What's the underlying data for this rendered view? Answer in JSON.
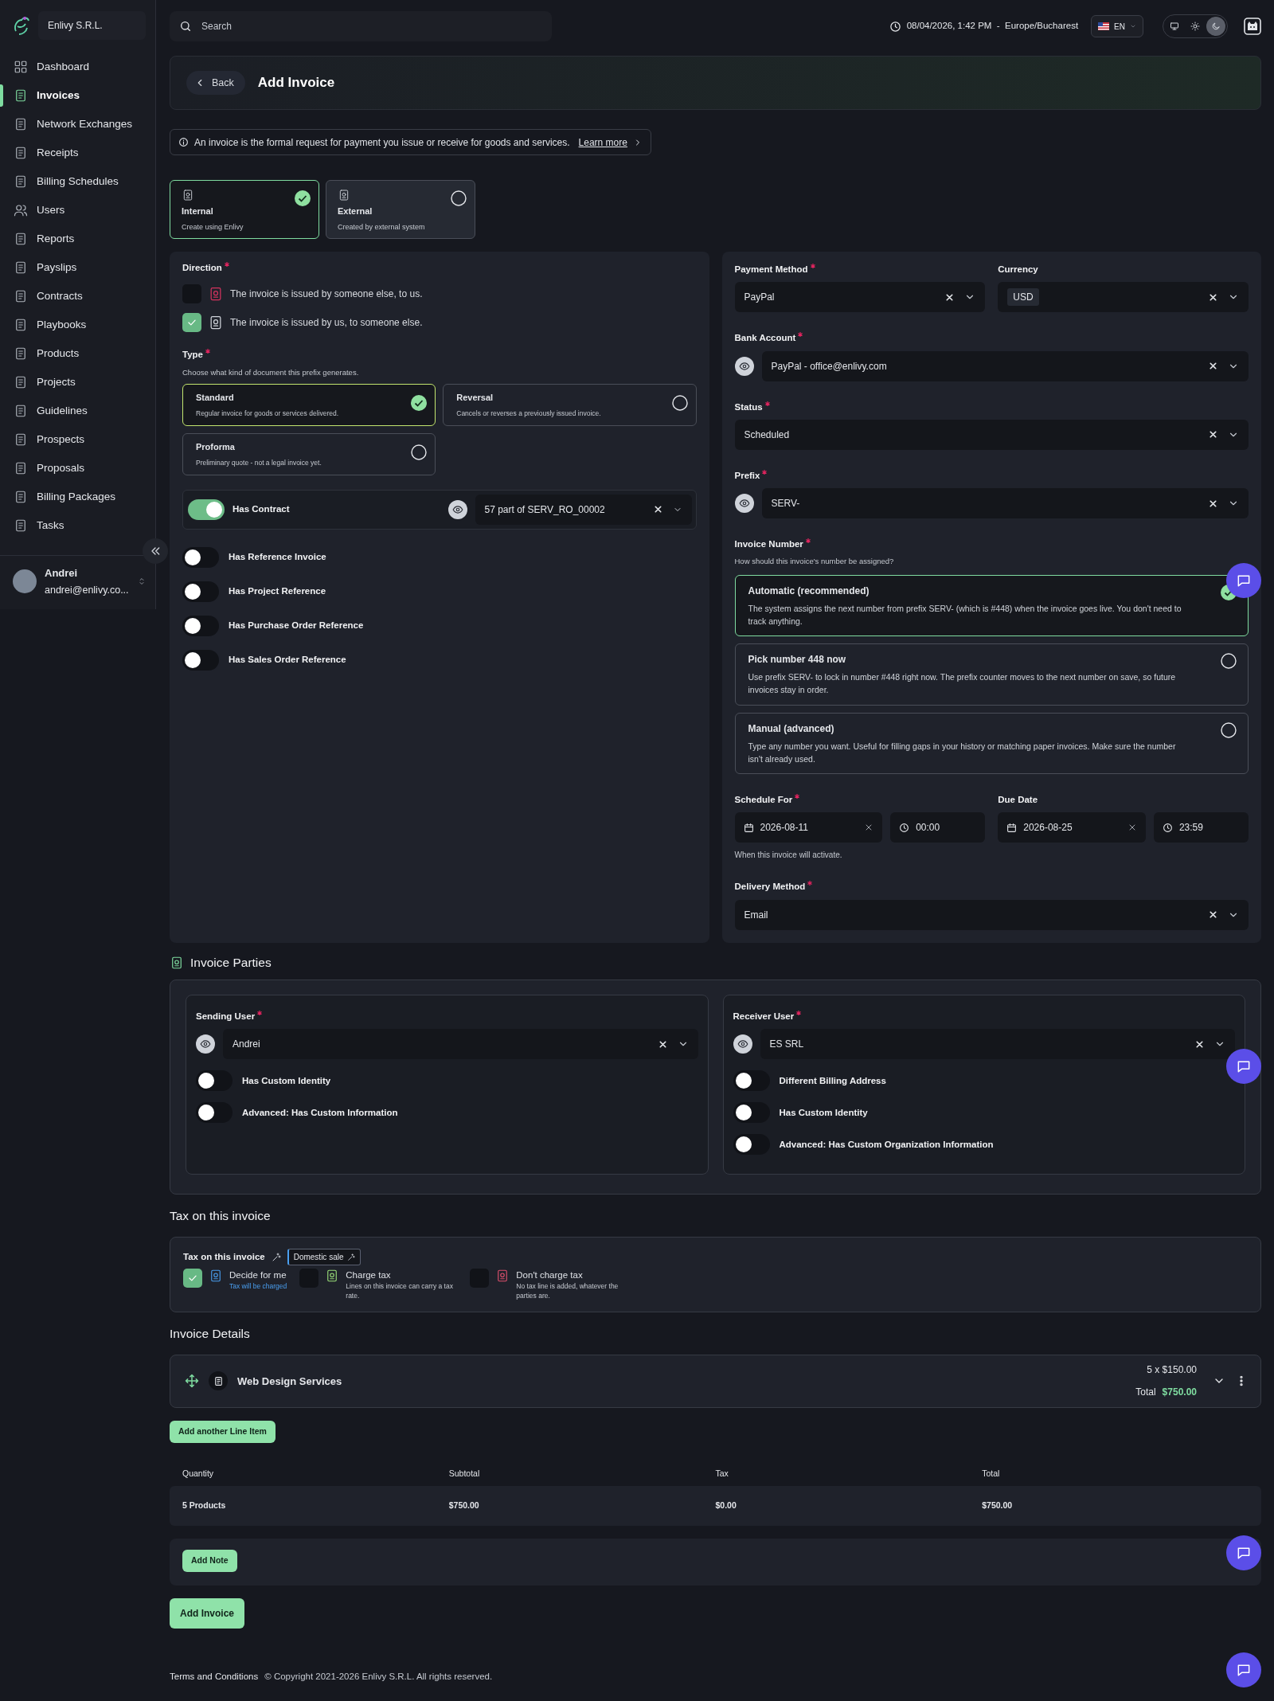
{
  "sidebar": {
    "company": "Enlivy S.R.L.",
    "items": [
      {
        "label": "Dashboard",
        "selected": false
      },
      {
        "label": "Invoices",
        "selected": true
      },
      {
        "label": "Network Exchanges",
        "selected": false
      },
      {
        "label": "Receipts",
        "selected": false
      },
      {
        "label": "Billing Schedules",
        "selected": false
      },
      {
        "label": "Users",
        "selected": false
      },
      {
        "label": "Reports",
        "selected": false
      },
      {
        "label": "Payslips",
        "selected": false
      },
      {
        "label": "Contracts",
        "selected": false
      },
      {
        "label": "Playbooks",
        "selected": false
      },
      {
        "label": "Products",
        "selected": false
      },
      {
        "label": "Projects",
        "selected": false
      },
      {
        "label": "Guidelines",
        "selected": false
      },
      {
        "label": "Prospects",
        "selected": false
      },
      {
        "label": "Proposals",
        "selected": false
      },
      {
        "label": "Billing Packages",
        "selected": false
      },
      {
        "label": "Tasks",
        "selected": false
      }
    ],
    "user": {
      "name": "Andrei",
      "email": "andrei@enlivy.co..."
    }
  },
  "topbar": {
    "search": {
      "placeholder": "Search"
    },
    "datetime": "08/04/2026, 1:42 PM  -  Europe/Bucharest",
    "language": "EN",
    "theme_modes": [
      {
        "kind": "system",
        "selected": false
      },
      {
        "kind": "light",
        "selected": false
      },
      {
        "kind": "dark",
        "selected": true
      }
    ]
  },
  "header": {
    "back": "Back",
    "title": "Add Invoice"
  },
  "info": {
    "text": "An invoice is the formal request for payment you issue or receive for goods and services.",
    "link": "Learn more"
  },
  "sources": [
    {
      "title": "Internal",
      "subtitle": "Create using Enlivy",
      "selected": true
    },
    {
      "title": "External",
      "subtitle": "Created by external system",
      "selected": false
    }
  ],
  "direction": {
    "label": "Direction",
    "required": true,
    "options": [
      {
        "text": "The invoice is issued by someone else, to us.",
        "checked": false,
        "kind": "incoming"
      },
      {
        "text": "The invoice is issued by us, to someone else.",
        "checked": true,
        "kind": "outgoing"
      }
    ]
  },
  "type": {
    "label": "Type",
    "required": true,
    "hint": "Choose what kind of document this prefix generates.",
    "options": [
      {
        "title": "Standard",
        "description": "Regular invoice for goods or services delivered.",
        "selected": true
      },
      {
        "title": "Reversal",
        "description": "Cancels or reverses a previously issued invoice.",
        "selected": false
      },
      {
        "title": "Proforma",
        "description": "Preliminary quote - not a legal invoice yet.",
        "selected": false
      }
    ]
  },
  "contract": {
    "label": "Has Contract",
    "on": true,
    "value": "57 part of SERV_RO_00002"
  },
  "toggles": [
    {
      "label": "Has Reference Invoice",
      "on": false
    },
    {
      "label": "Has Project Reference",
      "on": false
    },
    {
      "label": "Has Purchase Order Reference",
      "on": false
    },
    {
      "label": "Has Sales Order Reference",
      "on": false
    }
  ],
  "payment_method": {
    "label": "Payment Method",
    "required": true,
    "value": "PayPal"
  },
  "currency": {
    "label": "Currency",
    "required": false,
    "value": "USD"
  },
  "bank_account": {
    "label": "Bank Account",
    "required": true,
    "value": "PayPal - office@enlivy.com"
  },
  "status": {
    "label": "Status",
    "required": true,
    "value": "Scheduled"
  },
  "prefix": {
    "label": "Prefix",
    "required": true,
    "value": "SERV-"
  },
  "invoice_number": {
    "label": "Invoice Number",
    "required": true,
    "hint": "How should this invoice's number be assigned?",
    "options": [
      {
        "title": "Automatic (recommended)",
        "description": "The system assigns the next number from prefix SERV- (which is #448) when the invoice goes live. You don't need to track anything.",
        "selected": true
      },
      {
        "title": "Pick number 448 now",
        "description": "Use prefix SERV- to lock in number #448 right now. The prefix counter moves to the next number on save, so future invoices stay in order.",
        "selected": false
      },
      {
        "title": "Manual (advanced)",
        "description": "Type any number you want. Useful for filling gaps in your history or matching paper invoices. Make sure the number isn't already used.",
        "selected": false
      }
    ]
  },
  "schedule_for": {
    "label": "Schedule For",
    "required": true,
    "date": "2026-08-11",
    "time": "00:00",
    "hint": "When this invoice will activate."
  },
  "due_date": {
    "label": "Due Date",
    "required": false,
    "date": "2026-08-25",
    "time": "23:59"
  },
  "delivery_method": {
    "label": "Delivery Method",
    "required": true,
    "value": "Email"
  },
  "parties": {
    "heading": "Invoice Parties",
    "sides": [
      {
        "label": "Sending User",
        "required": true,
        "value": "Andrei",
        "toggles": [
          {
            "label": "Has Custom Identity",
            "on": false
          },
          {
            "label": "Advanced: Has Custom Information",
            "on": false
          }
        ]
      },
      {
        "label": "Receiver User",
        "required": true,
        "value": "ES SRL",
        "toggles": [
          {
            "label": "Different Billing Address",
            "on": false
          },
          {
            "label": "Has Custom Identity",
            "on": false
          },
          {
            "label": "Advanced: Has Custom Organization Information",
            "on": false
          }
        ]
      }
    ]
  },
  "tax": {
    "heading": "Tax on this invoice",
    "label": "Tax on this invoice",
    "tag": "Domestic sale",
    "options": [
      {
        "title": "Decide for me",
        "note": "Tax will be charged",
        "checked": true,
        "kind": "auto"
      },
      {
        "title": "Charge tax",
        "note": "Lines on this invoice can carry a tax rate.",
        "checked": false,
        "kind": "charge"
      },
      {
        "title": "Don't charge tax",
        "note": "No tax line is added, whatever the parties are.",
        "checked": false,
        "kind": "none"
      }
    ]
  },
  "details": {
    "heading": "Invoice Details",
    "line_items": [
      {
        "name": "Web Design Services",
        "quantity_price": "5 x $150.00",
        "total_label": "Total",
        "total": "$750.00"
      }
    ],
    "add_line": "Add another Line Item",
    "summary": {
      "columns": [
        "Quantity",
        "Subtotal",
        "Tax",
        "Total"
      ],
      "rows": [
        [
          "5 Products",
          "$750.00",
          "$0.00",
          "$750.00"
        ]
      ]
    },
    "add_note": "Add Note",
    "submit": "Add Invoice"
  },
  "footer": {
    "link": "Terms and Conditions",
    "copyright": "© Copyright 2021-2026 Enlivy S.R.L. All rights reserved."
  }
}
